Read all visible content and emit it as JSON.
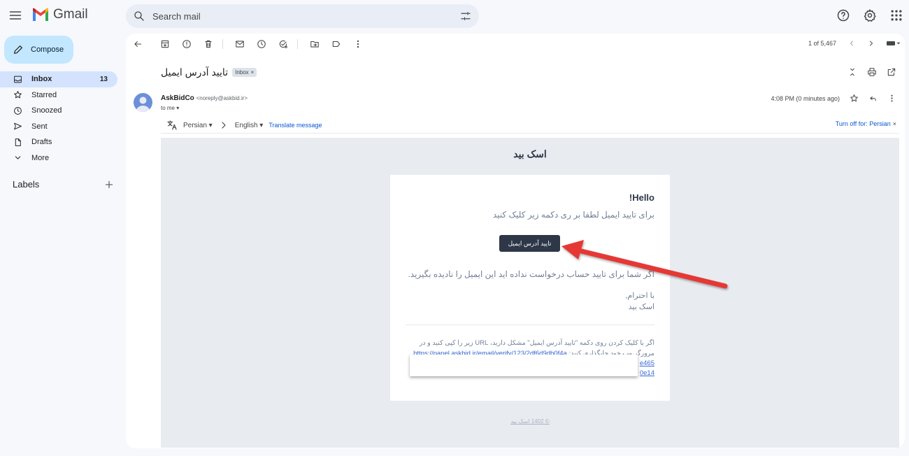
{
  "header": {
    "app_name": "Gmail",
    "search_placeholder": "Search mail"
  },
  "compose": {
    "label": "Compose"
  },
  "sidebar": {
    "items": [
      {
        "label": "Inbox",
        "count": "13",
        "icon": "inbox-icon",
        "active": true
      },
      {
        "label": "Starred",
        "count": "",
        "icon": "star-icon"
      },
      {
        "label": "Snoozed",
        "count": "",
        "icon": "clock-icon"
      },
      {
        "label": "Sent",
        "count": "",
        "icon": "send-icon"
      },
      {
        "label": "Drafts",
        "count": "",
        "icon": "draft-icon"
      },
      {
        "label": "More",
        "count": "",
        "icon": "chevron-down-icon"
      }
    ],
    "labels_title": "Labels"
  },
  "pager": {
    "text": "1 of 5,467"
  },
  "message": {
    "subject": "تایید آدرس ایمیل",
    "inbox_chip": "Inbox",
    "chip_close": "×",
    "sender_name": "AskBidCo",
    "sender_email": "<noreply@askbid.ir>",
    "to": "to me",
    "time": "4:08 PM (0 minutes ago)"
  },
  "translate": {
    "from": "Persian",
    "to": "English",
    "link": "Translate message",
    "turn_off": "Turn off for: Persian",
    "close": "×"
  },
  "email": {
    "brand": "اسک بید",
    "hello": "Hello!",
    "instruction": "برای تایید ایمیل لطفا بر ری دکمه زیر کلیک کنید",
    "button": "تایید آدرس ایمیل",
    "ignore": "اگر شما برای تایید حساب درخواست نداده اید این ایمیل را نادیده بگیرید.",
    "regards_1": "با احترام,",
    "regards_2": "اسک بید",
    "footer_1": "اگر با کلیک کردن روی دکمه \"تایید آدرس ایمیل\" مشکل دارید، URL زیر را کپی کنید و در مرورگر وب خود جایگذاری کنید:",
    "footer_link": "https://panel.askbid.ir/email/verify/123/2df6d9db0f4a",
    "link_peek_1": "e465",
    "link_peek_2": "0e14",
    "copyright": "© 1402 اسک بید"
  },
  "colors": {
    "accent": "#0b57d0",
    "compose_bg": "#c2e7ff",
    "active_nav": "#d3e3fd",
    "button_dark": "#2d3748",
    "arrow": "#e53935"
  }
}
